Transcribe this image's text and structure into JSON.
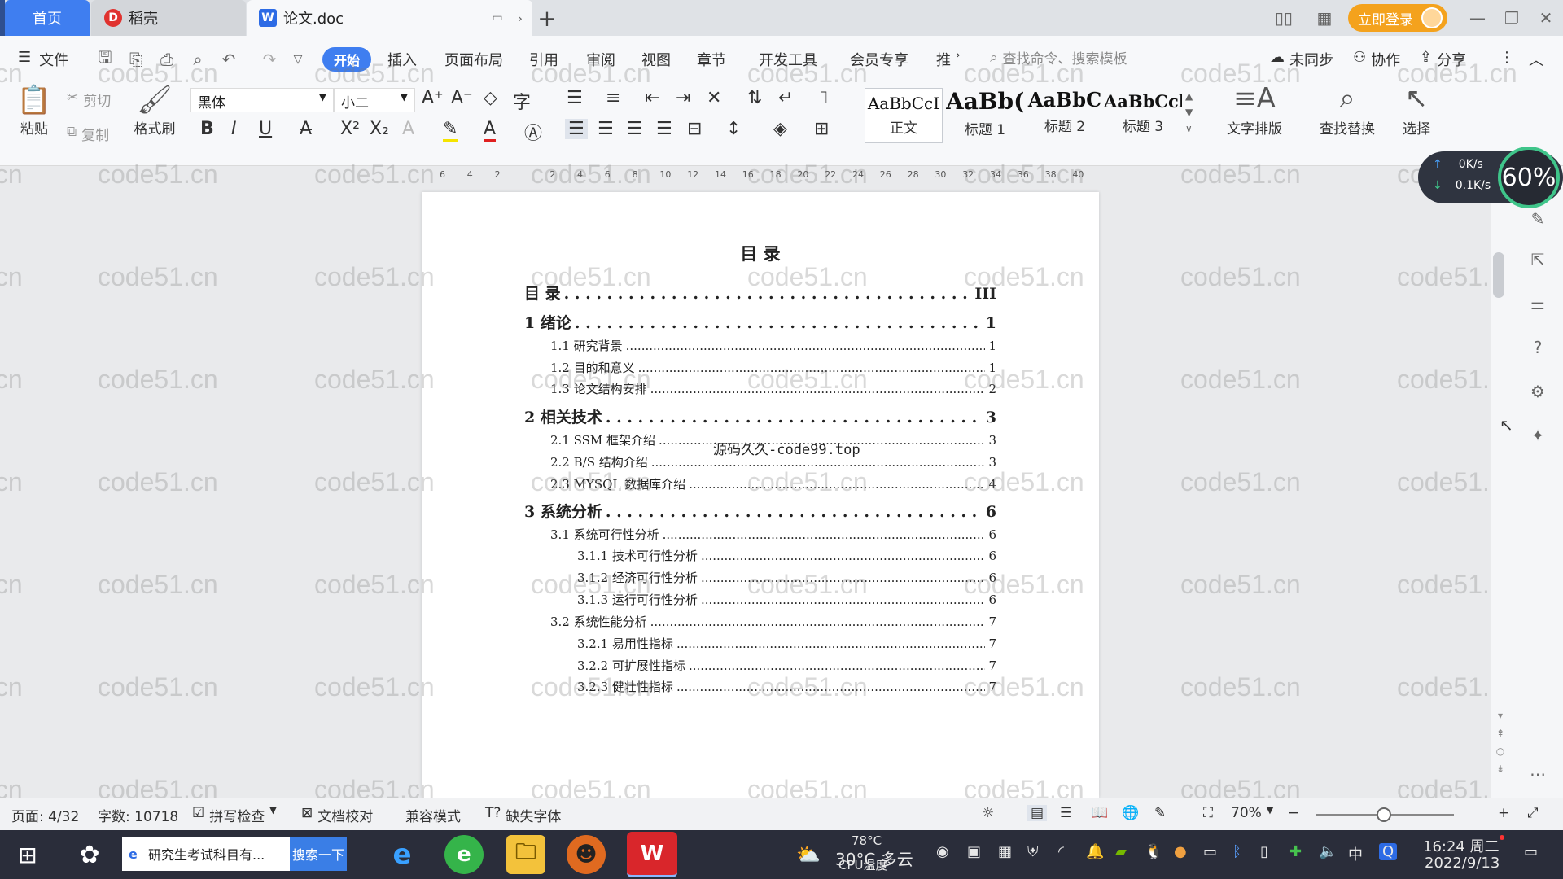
{
  "tabs": {
    "home": "首页",
    "docer": "稻壳",
    "doc": "论文.doc",
    "new_tab": "+"
  },
  "titlebar": {
    "login": "立即登录"
  },
  "menu": {
    "file": "文件",
    "items": [
      "开始",
      "插入",
      "页面布局",
      "引用",
      "审阅",
      "视图",
      "章节",
      "开发工具",
      "会员专享",
      "推"
    ],
    "search_placeholder": "查找命令、搜索模板",
    "sync": "未同步",
    "collab": "协作",
    "share": "分享"
  },
  "ribbon": {
    "paste": "粘贴",
    "cut": "剪切",
    "copy": "复制",
    "format_painter": "格式刷",
    "font_name": "黑体",
    "font_size": "小二",
    "styles": [
      {
        "preview": "AaBbCcI",
        "label": "正文"
      },
      {
        "preview": "AaBb(",
        "label": "标题 1"
      },
      {
        "preview": "AaBbC",
        "label": "标题 2"
      },
      {
        "preview": "AaBbCcl",
        "label": "标题 3"
      }
    ],
    "text_layout": "文字排版",
    "find_replace": "查找替换",
    "select": "选择"
  },
  "ruler": {
    "ticks": [
      "6",
      "4",
      "2",
      "",
      "2",
      "4",
      "6",
      "8",
      "10",
      "12",
      "14",
      "16",
      "18",
      "20",
      "22",
      "24",
      "26",
      "28",
      "30",
      "32",
      "34",
      "36",
      "38",
      "40"
    ]
  },
  "document": {
    "title": "目 录",
    "toc": [
      {
        "level": 1,
        "text": "目 录",
        "page": "III"
      },
      {
        "level": 1,
        "text": "1 绪论",
        "page": "1"
      },
      {
        "level": 2,
        "text": "1.1 研究背景",
        "page": "1"
      },
      {
        "level": 2,
        "text": "1.2 目的和意义",
        "page": "1"
      },
      {
        "level": 2,
        "text": "1.3 论文结构安排",
        "page": "2"
      },
      {
        "level": 1,
        "text": "2 相关技术",
        "page": "3"
      },
      {
        "level": 2,
        "text": "2.1 SSM 框架介绍",
        "page": "3"
      },
      {
        "level": 2,
        "text": "2.2 B/S 结构介绍",
        "page": "3"
      },
      {
        "level": 2,
        "text": "2.3 MYSQL 数据库介绍",
        "page": "4"
      },
      {
        "level": 1,
        "text": "3 系统分析",
        "page": "6"
      },
      {
        "level": 2,
        "text": "3.1 系统可行性分析",
        "page": "6"
      },
      {
        "level": 3,
        "text": "3.1.1 技术可行性分析",
        "page": "6"
      },
      {
        "level": 3,
        "text": "3.1.2 经济可行性分析",
        "page": "6"
      },
      {
        "level": 3,
        "text": "3.1.3 运行可行性分析",
        "page": "6"
      },
      {
        "level": 2,
        "text": "3.2 系统性能分析",
        "page": "7"
      },
      {
        "level": 3,
        "text": "3.2.1 易用性指标",
        "page": "7"
      },
      {
        "level": 3,
        "text": "3.2.2 可扩展性指标",
        "page": "7"
      },
      {
        "level": 3,
        "text": "3.2.3 健壮性指标",
        "page": "7"
      }
    ],
    "overlay": "源码久久-code99.top"
  },
  "watermark": "code51.cn",
  "speed": {
    "up": "0K/s",
    "down": "0.1K/s",
    "percent": "60%"
  },
  "status": {
    "page": "页面: 4/32",
    "words": "字数: 10718",
    "spell": "拼写检查",
    "proof": "文档校对",
    "compat": "兼容模式",
    "missing_font": "缺失字体",
    "zoom": "70%",
    "zoom_level": 0.7
  },
  "taskbar": {
    "search_text": "研究生考试科目有...",
    "search_btn": "搜索一下",
    "weather": "30°C 多云",
    "cpu_temp": "78°C",
    "cpu_label": "CPU温度",
    "ime": "中",
    "time": "16:24 周二",
    "date": "2022/9/13"
  }
}
